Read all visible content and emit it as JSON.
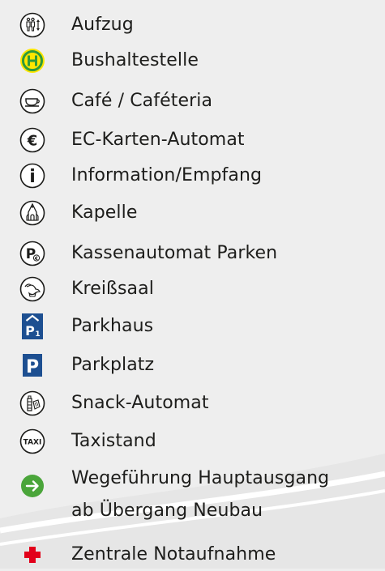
{
  "legend": {
    "items": [
      {
        "id": "aufzug",
        "icon": "elevator-icon",
        "label": "Aufzug"
      },
      {
        "id": "bushaltestelle",
        "icon": "bus-stop-icon",
        "label": "Bushaltestelle"
      },
      {
        "id": "cafe",
        "icon": "coffee-cup-icon",
        "label": "Café / Caféteria"
      },
      {
        "id": "ec-karten",
        "icon": "euro-icon",
        "label": "EC-Karten-Automat"
      },
      {
        "id": "information",
        "icon": "info-icon",
        "label": "Information/Empfang"
      },
      {
        "id": "kapelle",
        "icon": "chapel-icon",
        "label": "Kapelle"
      },
      {
        "id": "kassenautomat",
        "icon": "parking-payment-icon",
        "label": "Kassenautomat Parken"
      },
      {
        "id": "kreisssaal",
        "icon": "stork-icon",
        "label": "Kreißsaal"
      },
      {
        "id": "parkhaus",
        "icon": "parking-garage-icon",
        "label": "Parkhaus"
      },
      {
        "id": "parkplatz",
        "icon": "parking-icon",
        "label": "Parkplatz"
      },
      {
        "id": "snack",
        "icon": "snack-machine-icon",
        "label": "Snack-Automat"
      },
      {
        "id": "taxi",
        "icon": "taxi-icon",
        "label": "Taxistand"
      },
      {
        "id": "wegefuehrung",
        "icon": "arrow-right-icon",
        "label_line1": "Wegeführung Hauptausgang",
        "label_line2": "ab Übergang Neubau"
      },
      {
        "id": "notaufnahme",
        "icon": "red-cross-icon",
        "label": "Zentrale Notaufnahme"
      }
    ]
  },
  "colors": {
    "background": "#eeeeee",
    "text": "#1d1d1b",
    "bus_yellow": "#ffe600",
    "bus_green": "#2e9a3b",
    "parking_blue": "#1d4f91",
    "arrow_green": "#4aa53a",
    "cross_red": "#e2001a"
  }
}
